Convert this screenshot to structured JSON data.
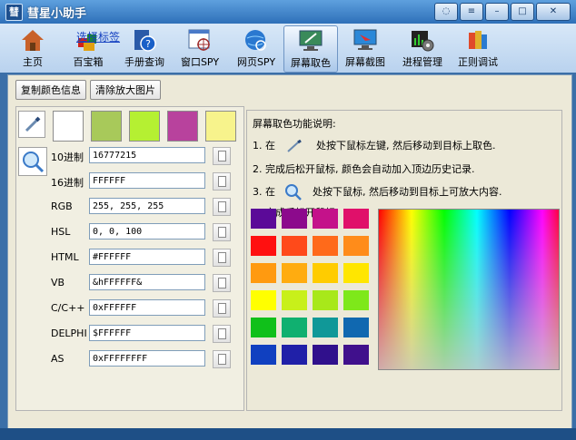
{
  "window": {
    "title": "彗星小助手",
    "app_icon_glyph": "彗"
  },
  "toolbar": {
    "tag_link": "选择标签",
    "items": [
      {
        "label": "主页",
        "icon": "house-icon"
      },
      {
        "label": "百宝箱",
        "icon": "cubes-icon"
      },
      {
        "label": "手册查询",
        "icon": "help-book-icon"
      },
      {
        "label": "窗口SPY",
        "icon": "window-crosshair-icon"
      },
      {
        "label": "网页SPY",
        "icon": "globe-crosshair-icon"
      },
      {
        "label": "屏幕取色",
        "icon": "screen-color-icon"
      },
      {
        "label": "屏幕截图",
        "icon": "screenshot-icon"
      },
      {
        "label": "进程管理",
        "icon": "process-gear-icon"
      },
      {
        "label": "正则调试",
        "icon": "regex-book-icon"
      }
    ]
  },
  "actions": {
    "copy_color_info": "复制颜色信息",
    "clear_zoom_image": "清除放大图片"
  },
  "history_colors": [
    "#ffffff",
    "#a8c95a",
    "#b5f032",
    "#b8429d",
    "#f7f38c"
  ],
  "fields": [
    {
      "label": "10进制",
      "value": "16777215"
    },
    {
      "label": "16进制",
      "value": "FFFFFF"
    },
    {
      "label": "RGB",
      "value": "255, 255, 255"
    },
    {
      "label": "HSL",
      "value": "0, 0, 100"
    },
    {
      "label": "HTML",
      "value": "#FFFFFF"
    },
    {
      "label": "VB",
      "value": "&hFFFFFF&"
    },
    {
      "label": "C/C++",
      "value": "0xFFFFFF"
    },
    {
      "label": "DELPHI",
      "value": "$FFFFFF"
    },
    {
      "label": "AS",
      "value": "0xFFFFFFFF"
    }
  ],
  "instructions": {
    "heading": "屏幕取色功能说明:",
    "step1_prefix": "1. 在",
    "step1_suffix": "处按下鼠标左键, 然后移动到目标上取色.",
    "step2": "2. 完成后松开鼠标, 颜色会自动加入顶边历史记录.",
    "step3_prefix": "3. 在",
    "step3_suffix": "处按下鼠标, 然后移动到目标上可放大内容.",
    "step4": "4. 完成后松开鼠标"
  },
  "palette": [
    [
      "#5b0a98",
      "#8c0a8c",
      "#c4128a",
      "#e0106a"
    ],
    [
      "#ff1010",
      "#ff4a1a",
      "#ff6a1a",
      "#ff8c1a"
    ],
    [
      "#ff9a10",
      "#ffac10",
      "#ffcc00",
      "#ffe600"
    ],
    [
      "#ffff00",
      "#c8f01a",
      "#a8e81a",
      "#7ee81a"
    ],
    [
      "#10c01a",
      "#10b070",
      "#109898",
      "#1068b0"
    ],
    [
      "#1040c0",
      "#2020a8",
      "#30108c",
      "#40108c"
    ]
  ]
}
